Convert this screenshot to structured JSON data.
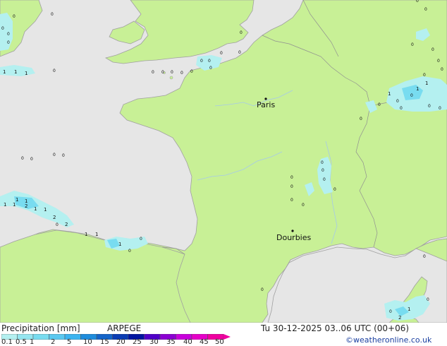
{
  "map": {
    "cities": [
      {
        "name": "Paris"
      },
      {
        "name": "Dourbies"
      }
    ],
    "precip_labels": [
      "1",
      "1",
      "1",
      "1",
      "2",
      "1",
      "1",
      "2",
      "2",
      "1",
      "1",
      "1",
      "1",
      "1",
      "1",
      "1",
      "1",
      "1",
      "2",
      "1"
    ]
  },
  "footer": {
    "title": "Precipitation [mm]",
    "model": "ARPEGE",
    "valid_time": "Tu 30-12-2025 03..06 UTC (00+06)",
    "credit": "©weatheronline.co.uk",
    "legend_ticks": [
      "0.1",
      "0.5",
      "1",
      "2",
      "5",
      "10",
      "15",
      "20",
      "25",
      "30",
      "35",
      "40",
      "45",
      "50"
    ],
    "legend_colors": [
      "#b4f0f0",
      "#96e6f0",
      "#78dcf0",
      "#5ac8f0",
      "#3cb4f0",
      "#1e8cdc",
      "#1464c8",
      "#0a3cb4",
      "#0014a0",
      "#5000c8",
      "#8c00d2",
      "#c800dc",
      "#e600c8",
      "#f000a0"
    ]
  }
}
